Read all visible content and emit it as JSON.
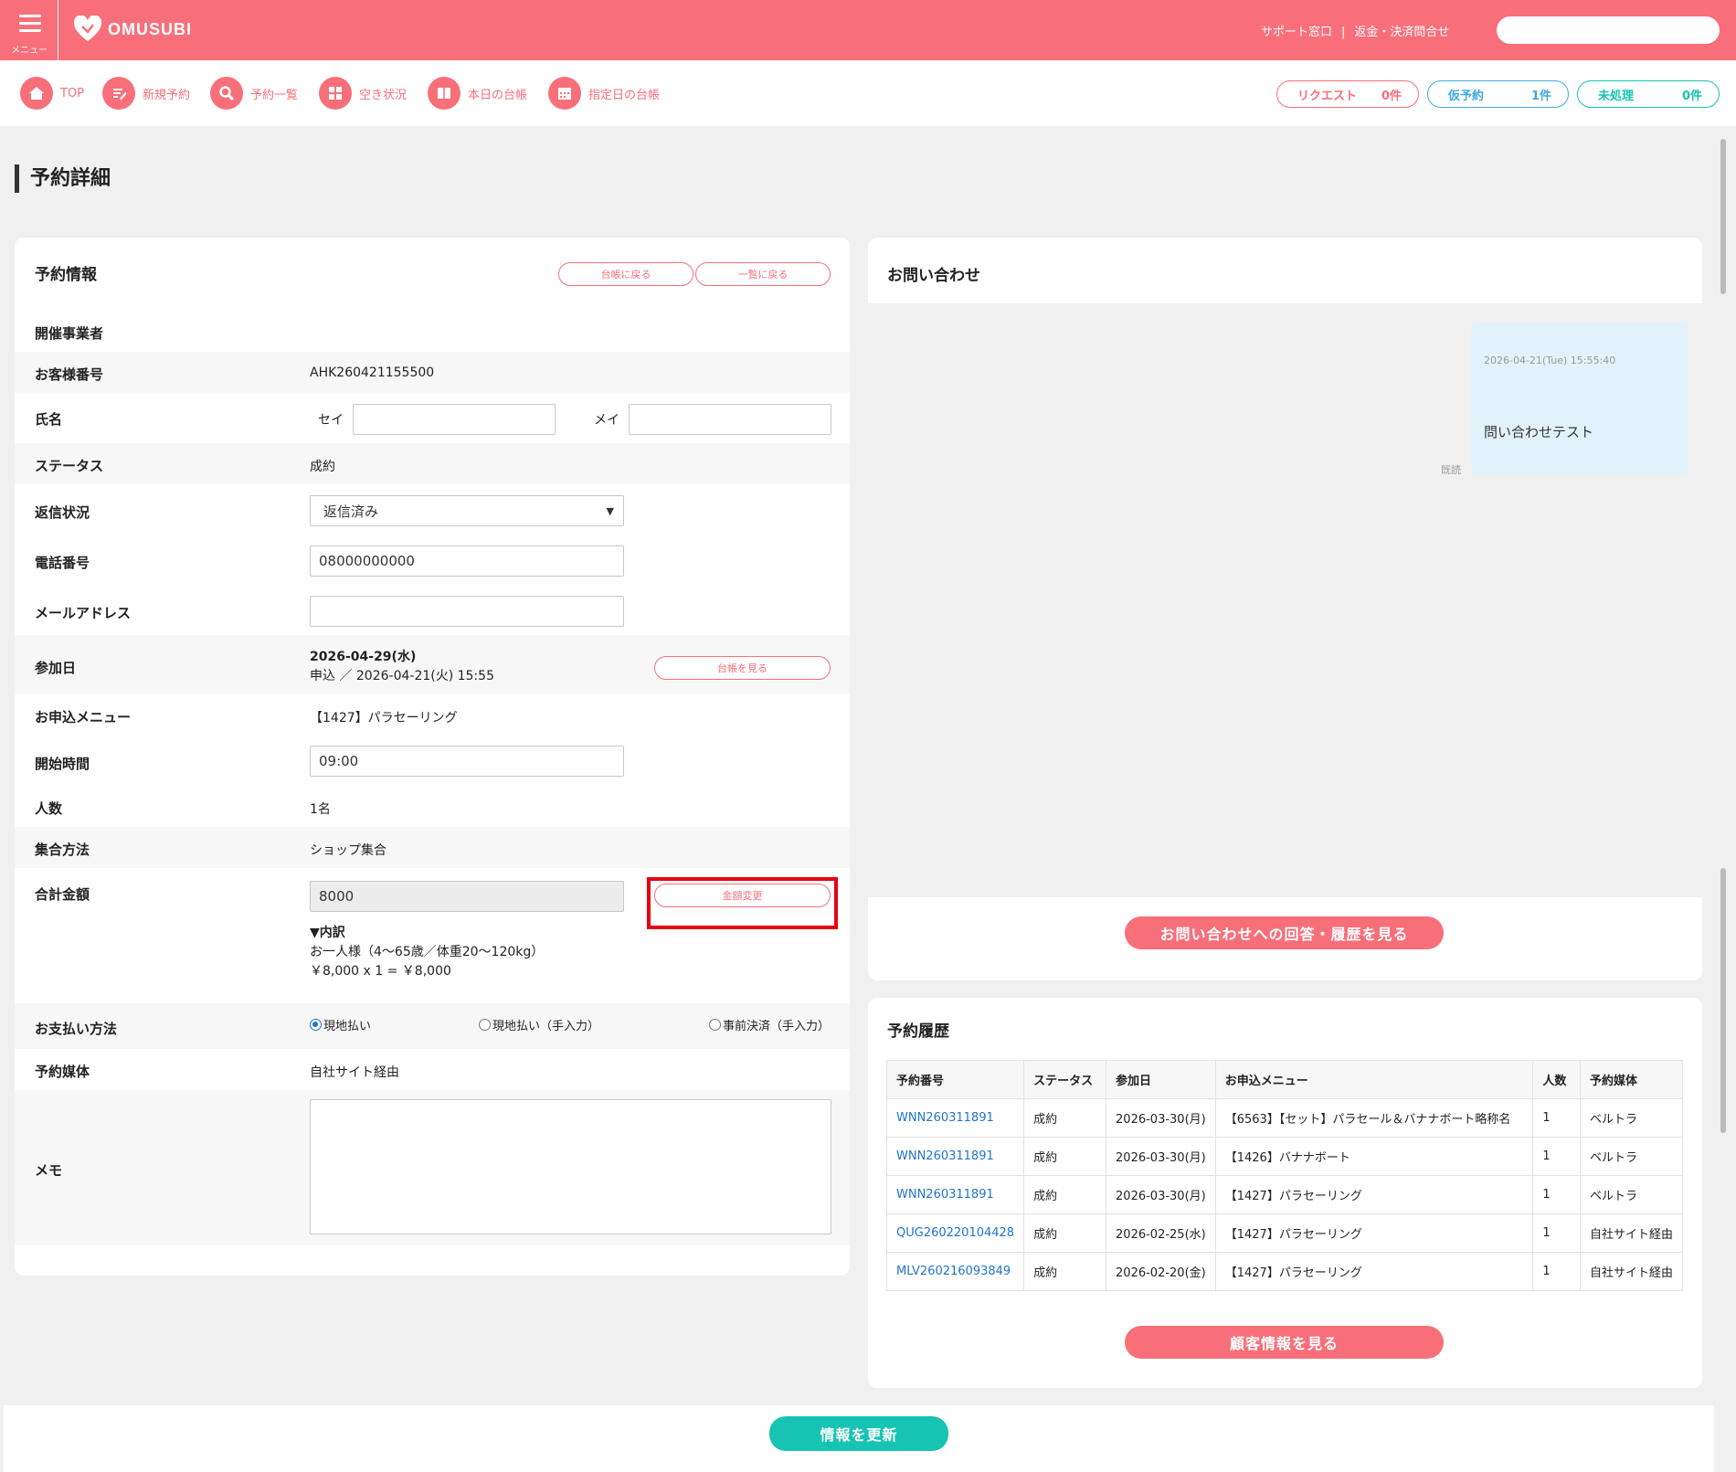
{
  "header": {
    "menu_label": "メニュー",
    "logo_text": "OMUSUBI",
    "support_link": "サポート窓口",
    "separator": "|",
    "refund_link": "返金・決済問合せ",
    "search_placeholder": ""
  },
  "nav": {
    "items": [
      {
        "label": "TOP",
        "icon": "home-icon"
      },
      {
        "label": "新規予約",
        "icon": "edit-icon"
      },
      {
        "label": "予約一覧",
        "icon": "search-icon"
      },
      {
        "label": "空き状況",
        "icon": "grid-icon"
      },
      {
        "label": "本日の台帳",
        "icon": "book-icon"
      },
      {
        "label": "指定日の台帳",
        "icon": "calendar-icon"
      }
    ]
  },
  "counters": {
    "request": {
      "label": "リクエスト",
      "count": "0件"
    },
    "tentative": {
      "label": "仮予約",
      "count": "1件"
    },
    "unprocessed": {
      "label": "未処理",
      "count": "0件"
    }
  },
  "page_title": "予約詳細",
  "booking": {
    "title": "予約情報",
    "back_ledger": "台帳に戻る",
    "back_list": "一覧に戻る",
    "labels": {
      "organizer": "開催事業者",
      "customer_no": "お客様番号",
      "name": "氏名",
      "status": "ステータス",
      "reply": "返信状況",
      "phone": "電話番号",
      "email": "メールアドレス",
      "date": "参加日",
      "menu": "お申込メニュー",
      "start": "開始時間",
      "people": "人数",
      "meeting": "集合方法",
      "total": "合計金額",
      "payment": "お支払い方法",
      "media": "予約媒体",
      "memo": "メモ"
    },
    "organizer": "",
    "customer_no": "AHK260421155500",
    "sei_label": "セイ",
    "mei_label": "メイ",
    "sei": "",
    "mei": "",
    "status": "成約",
    "reply": "返信済み",
    "phone": "08000000000",
    "email": "",
    "date": "2026-04-29(水)",
    "applied": "申込 ／ 2026-04-21(火) 15:55",
    "view_ledger": "台帳を見る",
    "menu": "【1427】パラセーリング",
    "start": "09:00",
    "people": "1名",
    "meeting": "ショップ集合",
    "total": "8000",
    "change_amount": "金額変更",
    "breakdown_title": "▼内訳",
    "breakdown_line1": "お一人様（4〜65歳／体重20〜120kg）",
    "breakdown_line2": "￥8,000 x 1 = ￥8,000",
    "payment_options": [
      "現地払い",
      "現地払い（手入力）",
      "事前決済（手入力）"
    ],
    "payment_selected": 0,
    "media": "自社サイト経由",
    "memo": ""
  },
  "inquiry": {
    "title": "お問い合わせ",
    "msg_time": "2026-04-21(Tue) 15:55:40",
    "msg_text": "問い合わせテスト",
    "read_label": "既読",
    "reply_button": "お問い合わせへの回答・履歴を見る"
  },
  "history": {
    "title": "予約履歴",
    "headers": [
      "予約番号",
      "ステータス",
      "参加日",
      "お申込メニュー",
      "人数",
      "予約媒体"
    ],
    "rows": [
      [
        "WNN260311891",
        "成約",
        "2026-03-30(月)",
        "【6563】【セット】パラセール＆バナナボート略称名",
        "1",
        "ベルトラ"
      ],
      [
        "WNN260311891",
        "成約",
        "2026-03-30(月)",
        "【1426】バナナボート",
        "1",
        "ベルトラ"
      ],
      [
        "WNN260311891",
        "成約",
        "2026-03-30(月)",
        "【1427】パラセーリング",
        "1",
        "ベルトラ"
      ],
      [
        "QUG260220104428",
        "成約",
        "2026-02-25(水)",
        "【1427】パラセーリング",
        "1",
        "自社サイト経由"
      ],
      [
        "MLV260216093849",
        "成約",
        "2026-02-20(金)",
        "【1427】パラセーリング",
        "1",
        "自社サイト経由"
      ]
    ],
    "customer_button": "顧客情報を見る"
  },
  "footer": {
    "update_button": "情報を更新"
  },
  "colors": {
    "brand": "#f86f7a",
    "teal": "#17c3b2",
    "blue_link": "#1e74d0",
    "highlight": "#e60012"
  }
}
